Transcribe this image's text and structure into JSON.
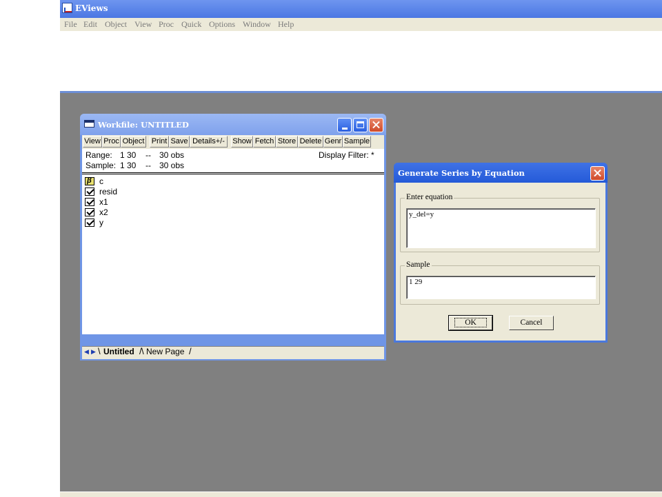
{
  "app": {
    "title": "EViews"
  },
  "menu": [
    "File",
    "Edit",
    "Object",
    "View",
    "Proc",
    "Quick",
    "Options",
    "Window",
    "Help"
  ],
  "workfile": {
    "title": "Workfile: UNTITLED",
    "toolbar": [
      "View",
      "Proc",
      "Object",
      "Print",
      "Save",
      "Details+/-",
      "Show",
      "Fetch",
      "Store",
      "Delete",
      "Genr",
      "Sample"
    ],
    "range_label": "Range:",
    "range_value": "1 30",
    "range_sep": "--",
    "range_obs": "30 obs",
    "display_filter": "Display Filter: *",
    "sample_label": "Sample:",
    "sample_value": "1 30",
    "sample_sep": "--",
    "sample_obs": "30 obs",
    "objects": [
      {
        "name": "c",
        "icon": "coefficient-icon"
      },
      {
        "name": "resid",
        "icon": "series-icon"
      },
      {
        "name": "x1",
        "icon": "series-icon"
      },
      {
        "name": "x2",
        "icon": "series-icon"
      },
      {
        "name": "y",
        "icon": "series-icon"
      }
    ],
    "tabs": {
      "active": "Untitled",
      "new_page": "New Page"
    }
  },
  "dialog": {
    "title": "Generate Series by Equation",
    "equation_label": "Enter equation",
    "equation_value": "y_del=y",
    "sample_label": "Sample",
    "sample_value": "1 29",
    "ok_label": "OK",
    "cancel_label": "Cancel"
  }
}
